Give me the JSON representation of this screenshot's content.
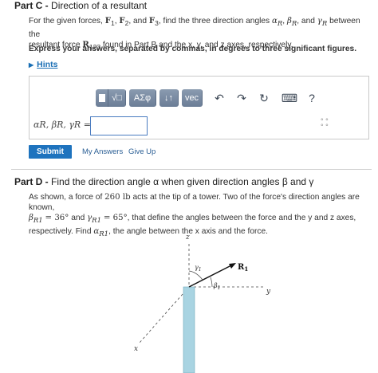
{
  "partC": {
    "header_bold": "Part C -",
    "header_text": "Direction of a resultant",
    "desc_a": "For the given forces,",
    "f1": "F",
    "f1_sub": "1",
    "sep1": ",",
    "f2": "F",
    "f2_sub": "2",
    "sep2": ", and",
    "f3": "F",
    "f3_sub": "3",
    "desc_b": ", find the three direction angles",
    "alpha": "α",
    "alpha_sub": "R",
    "beta": "β",
    "beta_sub": "R",
    "gamma": "γ",
    "gamma_sub": "R",
    "desc_c": "between the",
    "desc_d": "resultant force",
    "r123": "R",
    "r123_sub": "123",
    "desc_e": "found in Part B and the x, y, and z axes, respectively.",
    "instruction": "Express your answers, separated by commas, in degrees to three significant figures.",
    "hints": "Hints",
    "answer_label": "αR, βR, γR =",
    "answer_value": "",
    "toolbar": {
      "templates_icon": "template-icon",
      "sqrt_label": "√□",
      "greek_label": "ΑΣφ",
      "arrows_label": "↓↑",
      "vec_label": "vec",
      "undo_icon": "↶",
      "redo_icon": "↷",
      "reset_icon": "↻",
      "keyboard_icon": "⌨",
      "help_label": "?"
    },
    "submit": "Submit",
    "my_answers": "My Answers",
    "give_up": "Give Up"
  },
  "partD": {
    "header_bold": "Part D -",
    "header_text": "Find the direction angle α when given direction angles β and γ",
    "p1": "As shown, a force of",
    "force": "260 lb",
    "p2": "acts at the tip of a tower. Two of the force's direction angles are known,",
    "b_eq": "= 36°",
    "p3": "and",
    "g_eq": "= 65°",
    "p4": ", that define the angles between the force and the y and z axes,",
    "p5": "respectively. Find",
    "p6": ", the angle between the x axis and the force.",
    "sub_r1": "R1",
    "figure": {
      "z_label": "z",
      "y_label": "y",
      "x_label": "x",
      "r1_label": "R",
      "r1_sub": "1",
      "gamma_label": "γ",
      "gamma_sub": "1",
      "beta_label": "β",
      "beta_sub": "1"
    }
  },
  "colors": {
    "link": "#1a6fb5",
    "submit_bg": "#1e73be",
    "toolbar": "#7485a0",
    "tower": "#a9d4e2"
  }
}
